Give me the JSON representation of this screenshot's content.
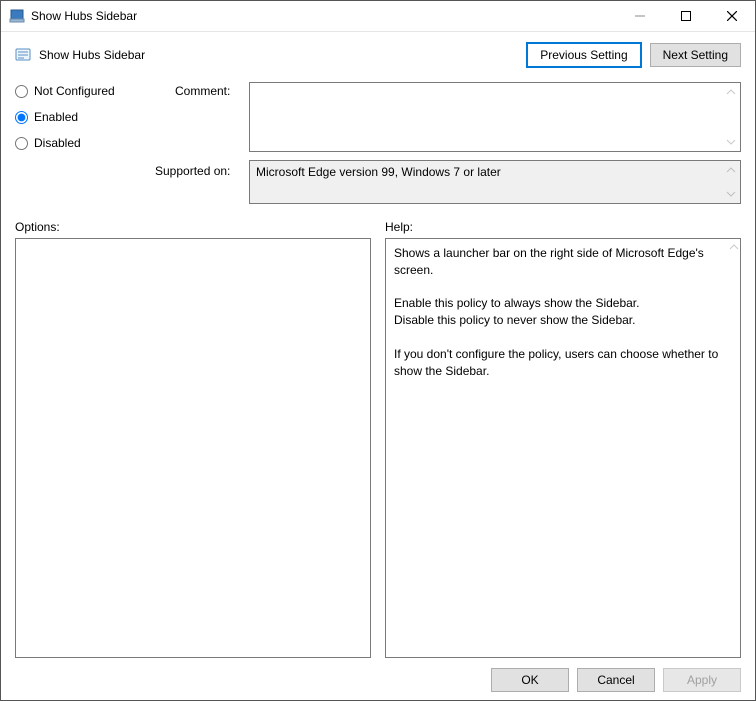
{
  "window": {
    "title": "Show Hubs Sidebar"
  },
  "header": {
    "policy_name": "Show Hubs Sidebar",
    "prev_label": "Previous Setting",
    "next_label": "Next Setting"
  },
  "state": {
    "not_configured_label": "Not Configured",
    "enabled_label": "Enabled",
    "disabled_label": "Disabled",
    "selected": "Enabled"
  },
  "labels": {
    "comment": "Comment:",
    "supported_on": "Supported on:",
    "options": "Options:",
    "help": "Help:"
  },
  "fields": {
    "comment_value": "",
    "supported_on_value": "Microsoft Edge version 99, Windows 7 or later"
  },
  "help_text": "Shows a launcher bar on the right side of Microsoft Edge's screen.\n\nEnable this policy to always show the Sidebar.\nDisable this policy to never show the Sidebar.\n\nIf you don't configure the policy, users can choose whether to show the Sidebar.",
  "footer": {
    "ok": "OK",
    "cancel": "Cancel",
    "apply": "Apply"
  }
}
